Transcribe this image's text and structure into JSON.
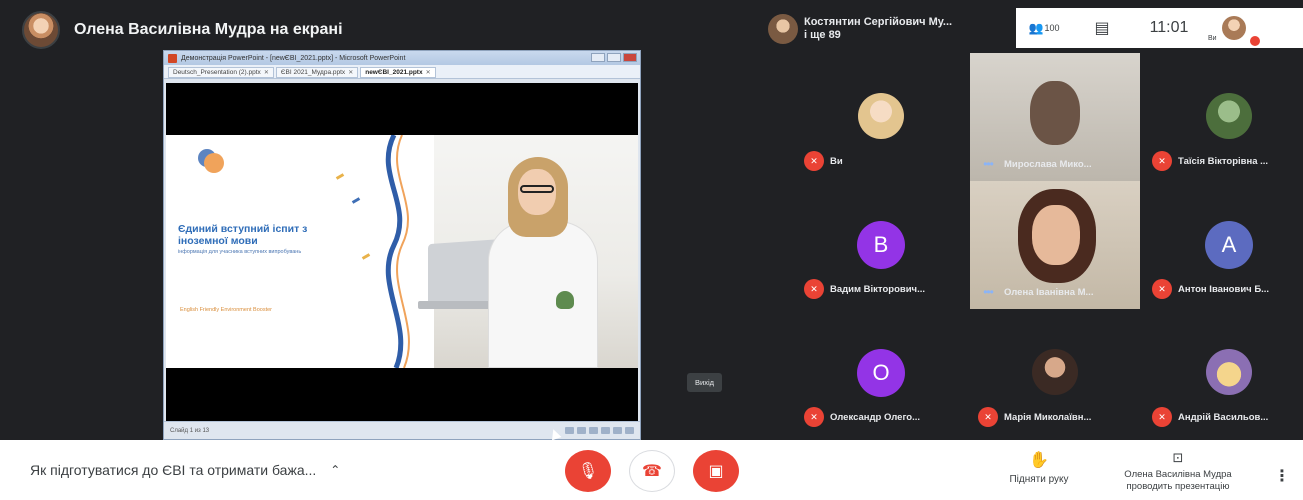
{
  "presenter": {
    "title": "Олена Василівна Мудра на екрані"
  },
  "screen": {
    "window_title": "Демонстрація PowerPoint - [newЄВІ_2021.pptx] - Microsoft PowerPoint",
    "tabs": [
      {
        "label": "Deutsch_Presentation (2).pptx"
      },
      {
        "label": "ЄВІ 2021_Мудра.pptx"
      },
      {
        "label": "newЄВІ_2021.pptx"
      }
    ],
    "slide": {
      "title": "Єдиний вступний іспит з іноземної мови",
      "subtitle": "інформація для учасника вступних випробувань",
      "footer": "English Friendly Environment Booster"
    },
    "status_text": "Слайд 1 из 13"
  },
  "tooltip": {
    "exit": "Вихід"
  },
  "room": {
    "line1": "Костянтин Сергійович Му...",
    "line2": "і ще 89"
  },
  "top_bar": {
    "people_count": "100",
    "clock": "11:01",
    "you_label": "Ви"
  },
  "participants": [
    {
      "name": "Ви",
      "type": "photo",
      "muted": true
    },
    {
      "name": "Мирослава Мико...",
      "type": "video",
      "muted": false
    },
    {
      "name": "Таїсія Вікторівна ...",
      "type": "photo",
      "muted": true
    },
    {
      "name": "Вадим Вікторович...",
      "type": "letter",
      "letter": "В",
      "color": "#9334e6",
      "muted": true
    },
    {
      "name": "Олена Іванівна М...",
      "type": "video",
      "muted": false
    },
    {
      "name": "Антон Іванович Б...",
      "type": "letter",
      "letter": "А",
      "color": "#5c6bc0",
      "muted": true
    },
    {
      "name": "Олександр Олего...",
      "type": "letter",
      "letter": "О",
      "color": "#9334e6",
      "muted": true
    },
    {
      "name": "Марія Миколаївн...",
      "type": "photo",
      "muted": true
    },
    {
      "name": "Андрій Васильов...",
      "type": "photo",
      "muted": true
    }
  ],
  "bottom": {
    "meeting_title": "Як підготуватися до ЄВІ та отримати бажа...",
    "raise_hand": "Підняти руку",
    "presenting_line1": "Олена Василівна Мудра",
    "presenting_line2": "проводить презентацію"
  },
  "colors": {
    "accent_red": "#ea4335",
    "bg_dark": "#202124"
  }
}
